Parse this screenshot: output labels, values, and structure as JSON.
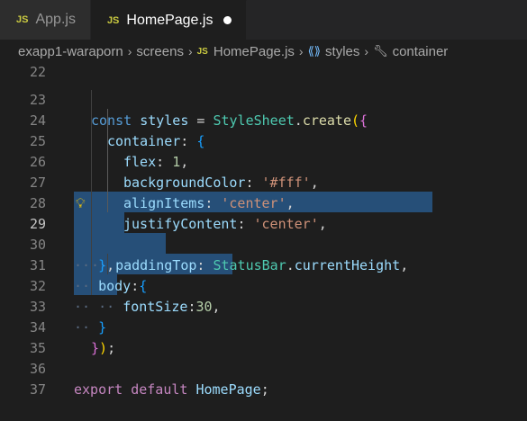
{
  "tabs": [
    {
      "label": "App.js",
      "icon": "JS",
      "active": false
    },
    {
      "label": "HomePage.js",
      "icon": "JS",
      "active": true,
      "modified": true
    }
  ],
  "breadcrumb": {
    "folder": "exapp1-waraporn",
    "subfolder": "screens",
    "file": "HomePage.js",
    "symbol1": "styles",
    "symbol2": "container"
  },
  "editor": {
    "partial_line_number": "22",
    "current_line": "29",
    "lines": [
      {
        "n": "23",
        "text": "const styles = StyleSheet.create({"
      },
      {
        "n": "24",
        "text": "container: {"
      },
      {
        "n": "25",
        "text": "flex: 1,"
      },
      {
        "n": "26",
        "text": "backgroundColor: '#fff',"
      },
      {
        "n": "27",
        "text": "alignItems: 'center',"
      },
      {
        "n": "28",
        "text": "justifyContent: 'center',"
      },
      {
        "n": "29",
        "text": "paddingTop: StatusBar.currentHeight,"
      },
      {
        "n": "30",
        "text": "},"
      },
      {
        "n": "31",
        "text": "body:{"
      },
      {
        "n": "32",
        "text": "fontSize:30,"
      },
      {
        "n": "33",
        "text": "}"
      },
      {
        "n": "34",
        "text": "});"
      },
      {
        "n": "35",
        "text": ""
      },
      {
        "n": "36",
        "text": "export default HomePage;"
      },
      {
        "n": "37",
        "text": ""
      }
    ]
  },
  "colors": {
    "background": "#1e1e1e",
    "selection": "#264f78",
    "keyword": "#569cd6",
    "class": "#4ec9b0",
    "string": "#ce9178",
    "number": "#b5cea8",
    "property": "#9cdcfe"
  }
}
